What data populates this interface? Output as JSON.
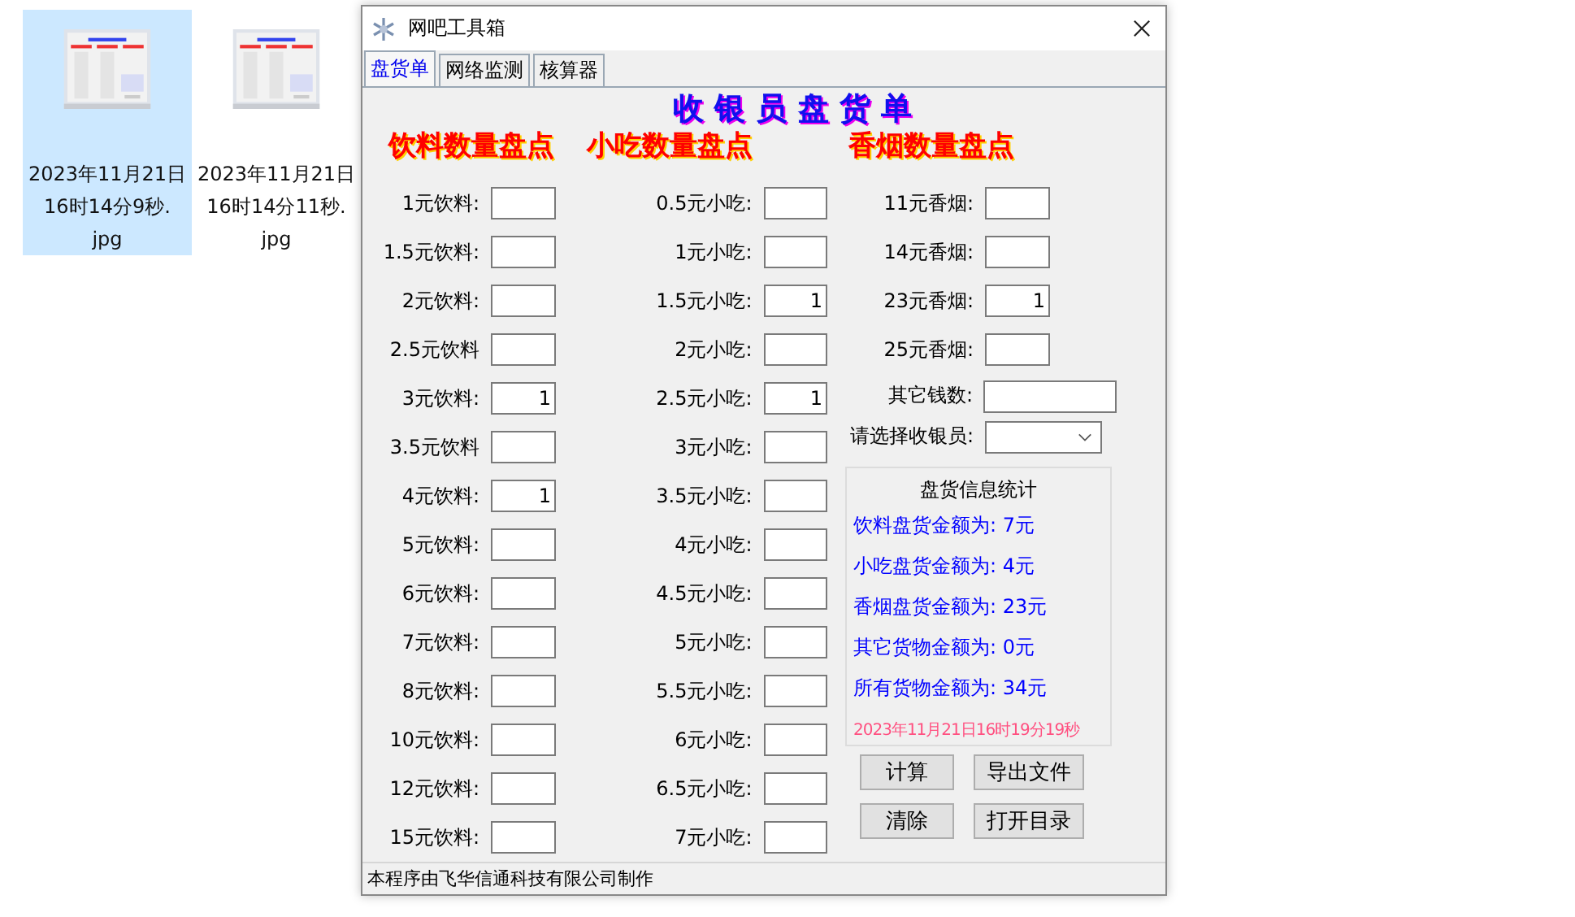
{
  "desktop_files": [
    {
      "label_lines": [
        "2023年11月21日",
        "16时14分9秒.",
        "jpg"
      ],
      "selected": true
    },
    {
      "label_lines": [
        "2023年11月21日",
        "16时14分11秒.",
        "jpg"
      ],
      "selected": false
    }
  ],
  "window": {
    "title": "网吧工具箱"
  },
  "tabs": [
    {
      "label": "盘货单",
      "selected": true
    },
    {
      "label": "网络监测",
      "selected": false
    },
    {
      "label": "核算器",
      "selected": false
    }
  ],
  "heading": "收 银 员 盘 货 单",
  "sections": [
    {
      "title": "饮料数量盘点",
      "items": [
        {
          "label": "1元饮料:"
        },
        {
          "label": "1.5元饮料:"
        },
        {
          "label": "2元饮料:"
        },
        {
          "label": "2.5元饮料"
        },
        {
          "label": "3元饮料:",
          "value": "1"
        },
        {
          "label": "3.5元饮料"
        },
        {
          "label": "4元饮料:",
          "value": "1"
        },
        {
          "label": "5元饮料:"
        },
        {
          "label": "6元饮料:"
        },
        {
          "label": "7元饮料:"
        },
        {
          "label": "8元饮料:"
        },
        {
          "label": "10元饮料:"
        },
        {
          "label": "12元饮料:"
        },
        {
          "label": "15元饮料:"
        }
      ]
    },
    {
      "title": "小吃数量盘点",
      "items": [
        {
          "label": "0.5元小吃:"
        },
        {
          "label": "1元小吃:"
        },
        {
          "label": "1.5元小吃:",
          "value": "1"
        },
        {
          "label": "2元小吃:"
        },
        {
          "label": "2.5元小吃:",
          "value": "1"
        },
        {
          "label": "3元小吃:"
        },
        {
          "label": "3.5元小吃:"
        },
        {
          "label": "4元小吃:"
        },
        {
          "label": "4.5元小吃:"
        },
        {
          "label": "5元小吃:"
        },
        {
          "label": "5.5元小吃:"
        },
        {
          "label": "6元小吃:"
        },
        {
          "label": "6.5元小吃:"
        },
        {
          "label": "7元小吃:"
        }
      ]
    },
    {
      "title": "香烟数量盘点",
      "items": [
        {
          "label": "11元香烟:"
        },
        {
          "label": "14元香烟:"
        },
        {
          "label": "23元香烟:",
          "value": "1"
        },
        {
          "label": "25元香烟:"
        }
      ]
    }
  ],
  "other_amount": {
    "label": "其它钱数:"
  },
  "cashier": {
    "label": "请选择收银员:"
  },
  "stats": {
    "title": "盘货信息统计",
    "lines": [
      "饮料盘货金额为: 7元",
      "小吃盘货金额为: 4元",
      "香烟盘货金额为: 23元",
      "其它货物金额为: 0元",
      "所有货物金额为: 34元"
    ],
    "timestamp": "2023年11月21日16时19分19秒"
  },
  "buttons": [
    "计算",
    "导出文件",
    "清除",
    "打开目录"
  ],
  "status_bar": "本程序由飞华信通科技有限公司制作"
}
